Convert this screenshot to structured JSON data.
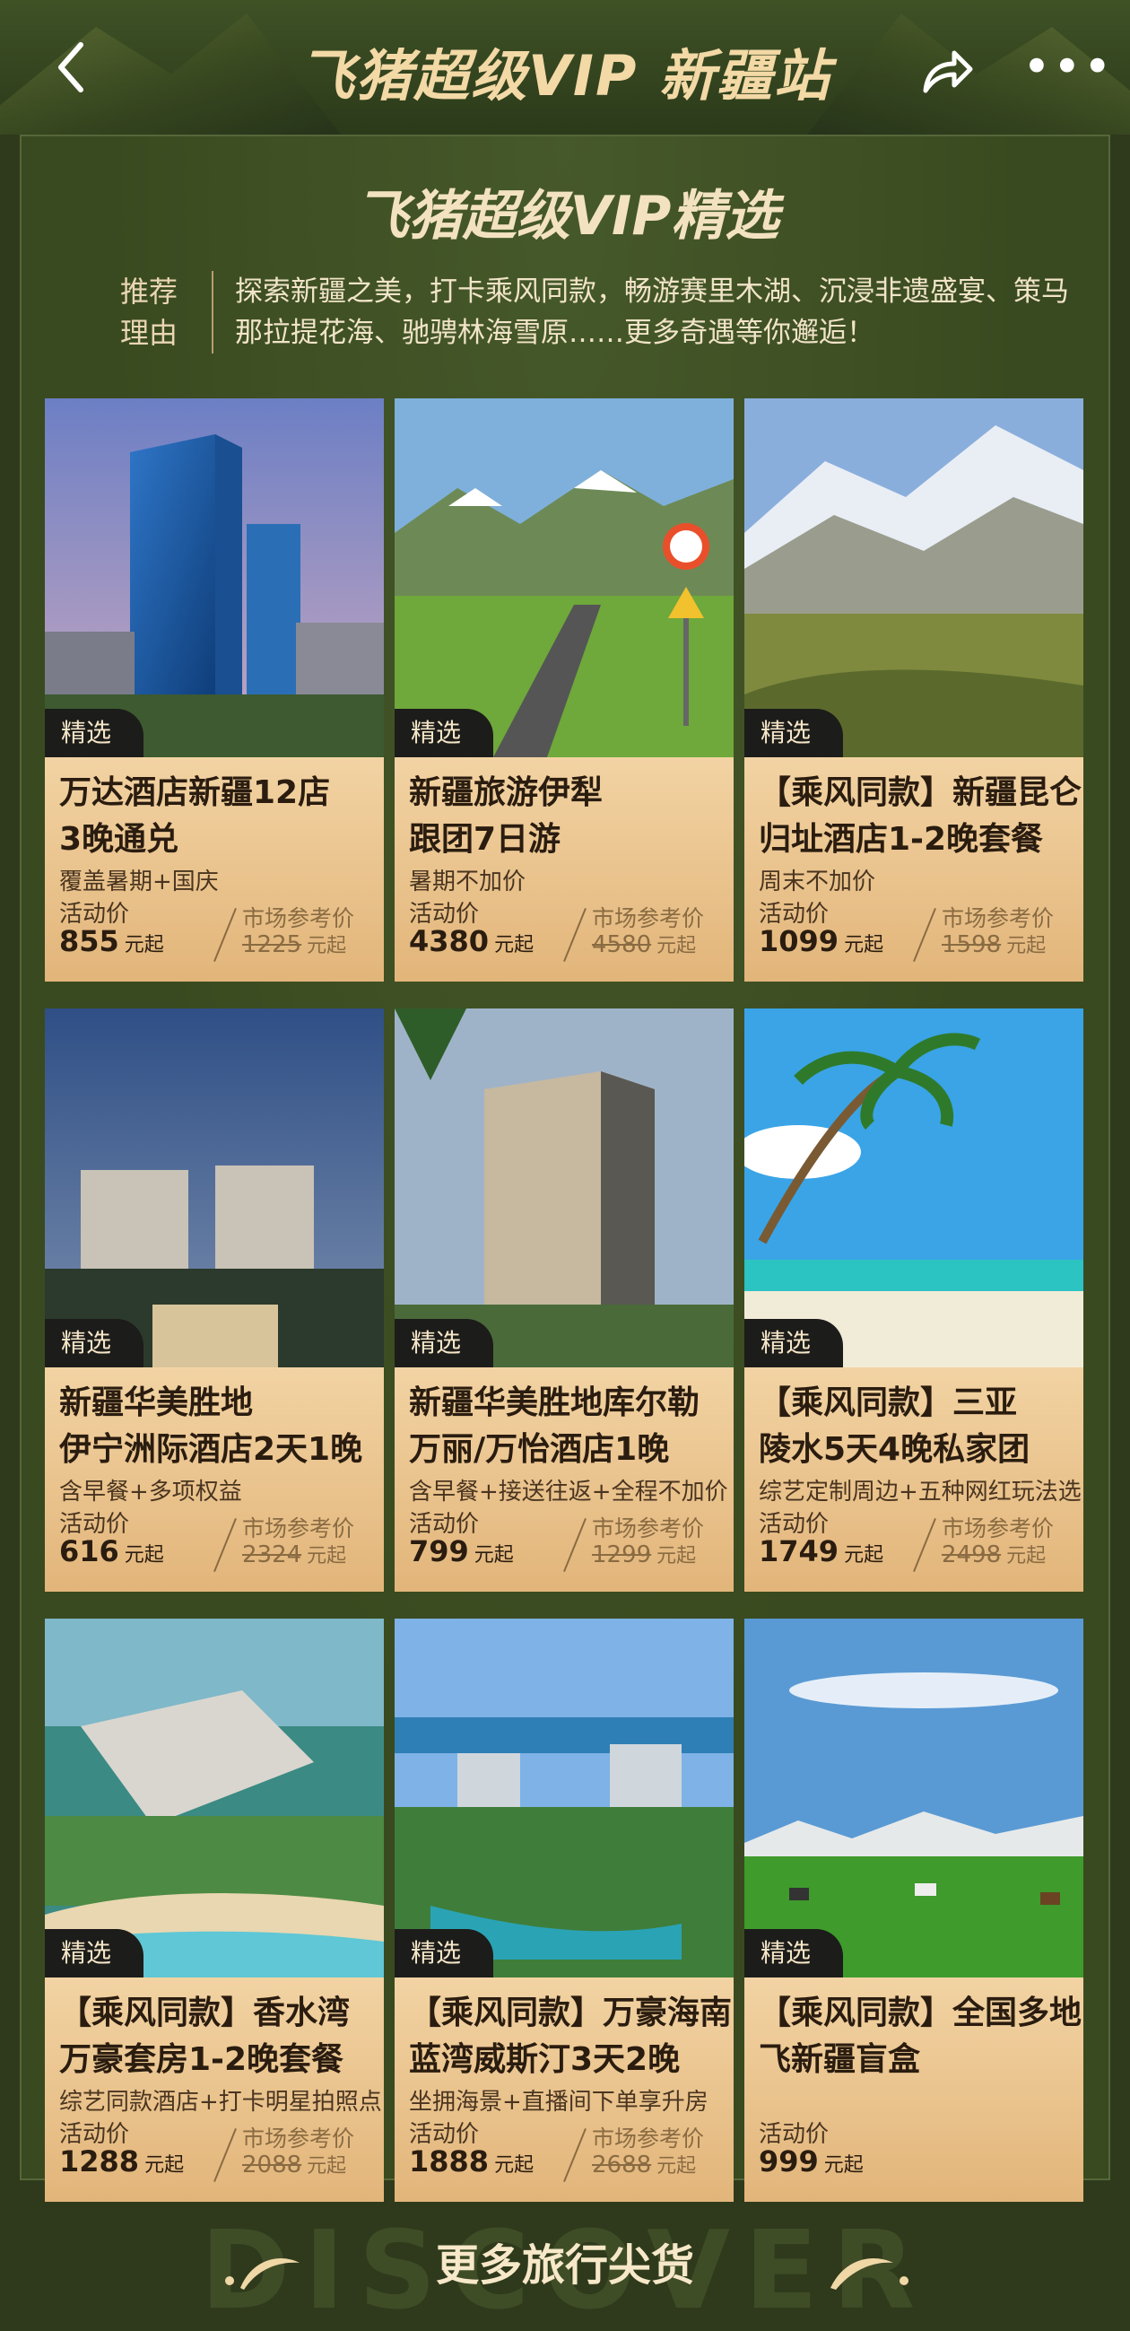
{
  "header": {
    "title": "飞猪超级VIP 新疆站",
    "back_icon": "back-arrow-icon",
    "share_icon": "share-icon",
    "more_icon": "more-dots-icon"
  },
  "panel": {
    "subtitle": "飞猪超级VIP精选",
    "reason_label": "推荐理由",
    "reason_text": "探索新疆之美，打卡乘风同款，畅游赛里木湖、沉浸非遗盛宴、策马那拉提花海、驰骋林海雪原……更多奇遇等你邂逅！"
  },
  "tag_label": "精选",
  "price_label": "活动价",
  "market_label": "市场参考价",
  "unit": "元起",
  "cards": [
    {
      "title1": "万达酒店新疆12店",
      "title2": "3晚通兑",
      "sub": "覆盖暑期+国庆",
      "price": "855",
      "market": "1225"
    },
    {
      "title1": "新疆旅游伊犁",
      "title2": "跟团7日游",
      "sub": "暑期不加价",
      "price": "4380",
      "market": "4580"
    },
    {
      "title1": "【乘风同款】新疆昆仑山",
      "title2": "归址酒店1-2晚套餐",
      "sub": "周末不加价",
      "price": "1099",
      "market": "1598"
    },
    {
      "title1": "新疆华美胜地",
      "title2": "伊宁洲际酒店2天1晚",
      "sub": "含早餐+多项权益",
      "price": "616",
      "market": "2324"
    },
    {
      "title1": "新疆华美胜地库尔勒",
      "title2": "万丽/万怡酒店1晚",
      "sub": "含早餐+接送往返+全程不加价",
      "price": "799",
      "market": "1299"
    },
    {
      "title1": "【乘风同款】三亚",
      "title2": "陵水5天4晚私家团",
      "sub": "综艺定制周边+五种网红玩法选",
      "price": "1749",
      "market": "2498"
    },
    {
      "title1": "【乘风同款】香水湾",
      "title2": "万豪套房1-2晚套餐",
      "sub": "综艺同款酒店+打卡明星拍照点",
      "price": "1288",
      "market": "2088"
    },
    {
      "title1": "【乘风同款】万豪海南",
      "title2": "蓝湾威斯汀3天2晚",
      "sub": "坐拥海景+直播间下单享升房",
      "price": "1888",
      "market": "2688"
    },
    {
      "title1": "【乘风同款】全国多地",
      "title2": "飞新疆盲盒",
      "sub": "",
      "price": "999",
      "market": ""
    }
  ],
  "footer": {
    "watermark": "DISCOVER",
    "more_label": "更多旅行尖货"
  },
  "colors": {
    "background": "#2f3a1c",
    "panel": "#3a4a20",
    "gold": "#f3d9a6",
    "card_bg": "#e2b57a"
  }
}
